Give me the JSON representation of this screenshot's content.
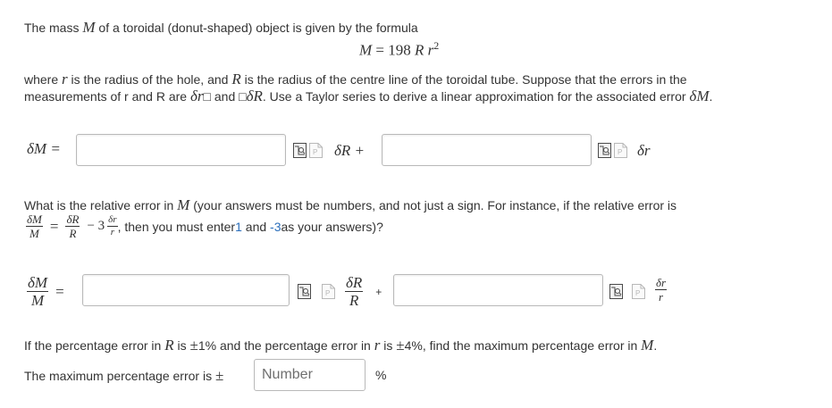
{
  "intro": {
    "part1": "The mass ",
    "var_M": "M",
    "part2": " of a toroidal (donut-shaped) object is given by the formula"
  },
  "formula": {
    "lhs": "M",
    "eq": " = 198 ",
    "R": "R",
    "r": "r",
    "exp": "2"
  },
  "desc": {
    "p1": "where ",
    "r": "r",
    "p2": " is the radius of the hole, and ",
    "R": "R",
    "p3": " is the radius of the centre line of the toroidal tube. Suppose that the errors in the",
    "p4": "measurements of r and R are ",
    "dr": "δr",
    "box1": "□",
    "p5": " and ",
    "box2": "□",
    "dR": "δR",
    "p6": ". Use a Taylor series to derive a linear approximation for the associated error ",
    "dM": "δM",
    "p7": "."
  },
  "row1": {
    "label": "δM =",
    "term1": "δR +",
    "term2": "δr",
    "input1_value": "",
    "input2_value": ""
  },
  "question2": {
    "p1": "What is the relative error in ",
    "M": "M",
    "p2": " (your answers must be numbers, and not just a sign. For instance, if the relative error is",
    "ex_num1": "δM",
    "ex_den1": "M",
    "ex_eq": "=",
    "ex_num2": "δR",
    "ex_den2": "R",
    "ex_minus3": "− 3",
    "ex_num3": "δr",
    "ex_den3": "r",
    "p3": ", then you must enter ",
    "one": "1",
    "p4": " and ",
    "minus3": "-3",
    "p5": " as your answers)?"
  },
  "row2": {
    "lhs_num": "δM",
    "lhs_den": "M",
    "eq": "=",
    "t1_num": "δR",
    "t1_den": "R",
    "plus": "+",
    "t2_num": "δr",
    "t2_den": "r",
    "input1_value": "",
    "input2_value": ""
  },
  "question3": {
    "p1": "If the percentage error in ",
    "R": "R",
    "p2": " is ",
    "pm1": "±",
    "p3": "1% and the percentage error in ",
    "r": "r",
    "p4": " is ",
    "pm2": "±",
    "p5": "4%, find the maximum percentage error in ",
    "M": "M",
    "p6": "."
  },
  "answer_row": {
    "label": "The maximum percentage error is ",
    "pm": "±",
    "placeholder": "Number",
    "percent": "%"
  },
  "icons": [
    "formula-editor-icon",
    "preview-icon"
  ],
  "colors": {
    "text": "#333333",
    "link_blue": "#2a6ebb",
    "input_border": "#b9b9b9"
  }
}
